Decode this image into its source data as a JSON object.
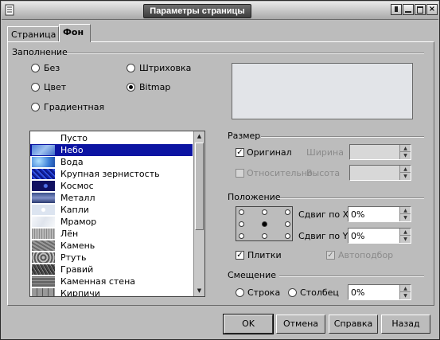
{
  "window": {
    "title": "Параметры страницы"
  },
  "tabs": [
    {
      "label": "Страница"
    },
    {
      "label": "Фон"
    }
  ],
  "fill": {
    "group_label": "Заполнение",
    "options": [
      "Без",
      "Цвет",
      "Градиентная",
      "Штриховка",
      "Bitmap"
    ],
    "selected": "Bitmap"
  },
  "bitmaps": {
    "items": [
      "Пусто",
      "Небо",
      "Вода",
      "Крупная зернистость",
      "Космос",
      "Металл",
      "Капли",
      "Мрамор",
      "Лён",
      "Камень",
      "Ртуть",
      "Гравий",
      "Каменная стена",
      "Кирпичи"
    ],
    "selected_index": 1
  },
  "size": {
    "group_label": "Размер",
    "original_label": "Оригинал",
    "relative_label": "Относительно",
    "width_label": "Ширина",
    "height_label": "Высота"
  },
  "position": {
    "group_label": "Положение",
    "offset_x_label": "Сдвиг по X",
    "offset_y_label": "Сдвиг по Y",
    "offset_x_value": "0%",
    "offset_y_value": "0%",
    "tile_label": "Плитки",
    "autofit_label": "Автоподбор"
  },
  "offset": {
    "group_label": "Смещение",
    "row_label": "Строка",
    "column_label": "Столбец",
    "value": "0%"
  },
  "buttons": {
    "ok": "OK",
    "cancel": "Отмена",
    "help": "Справка",
    "back": "Назад"
  },
  "colors": {
    "selection": "#0c14a2",
    "dialog": "#bcbcbc",
    "preview": "#e2e4e8"
  }
}
